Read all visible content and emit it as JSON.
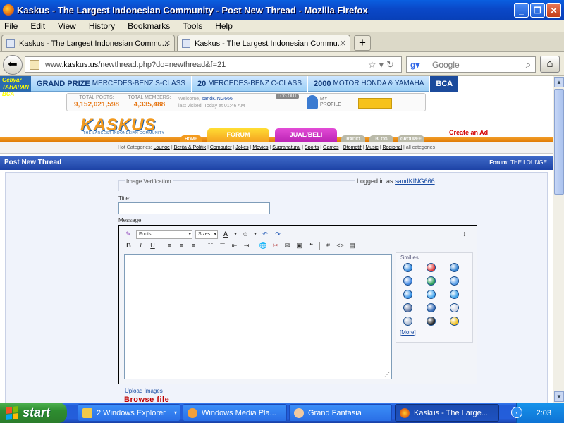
{
  "window": {
    "title": "Kaskus - The Largest Indonesian Community - Post New Thread - Mozilla Firefox"
  },
  "menu": [
    "File",
    "Edit",
    "View",
    "History",
    "Bookmarks",
    "Tools",
    "Help"
  ],
  "tabs": [
    {
      "label": "Kaskus - The Largest Indonesian Commu...",
      "active": false
    },
    {
      "label": "Kaskus - The Largest Indonesian Commu...",
      "active": true
    }
  ],
  "address": {
    "host": "www.",
    "domain": "kaskus.us",
    "path": "/newthread.php?do=newthread&f=21"
  },
  "search": {
    "placeholder": "Google"
  },
  "banner": {
    "logo": "Gebyar TAHAPAN BCA",
    "segments": [
      {
        "prefix": "GRAND PRIZE",
        "text": "MERCEDES-BENZ S-CLASS"
      },
      {
        "prefix": "20",
        "text": "MERCEDES-BENZ C-CLASS"
      },
      {
        "prefix": "2000",
        "text": "MOTOR HONDA & YAMAHA"
      }
    ],
    "bank": "BCA"
  },
  "userbox": {
    "posts_label": "TOTAL POSTS:",
    "posts": "9,152,021,598",
    "members_label": "TOTAL MEMBERS:",
    "members": "4,335,488",
    "welcome_prefix": "Welcome,",
    "username": "sandKING666",
    "last_visited": "last visited: Today at 01:46 AM",
    "logout": "LOG OUT",
    "profile_line1": "MY",
    "profile_line2": "PROFILE"
  },
  "site": {
    "logo": "KASKUS",
    "tagline": "THE LARGEST INDONESIAN COMMUNITY"
  },
  "nav": {
    "home": "HOME",
    "forum": "FORUM",
    "jualbeli": "JUAL/BELI",
    "radio": "RADIO",
    "blog": "BLOG",
    "groupee": "GROUPEE",
    "create_ad": "Create an Ad"
  },
  "hotcats": {
    "label": "Hot Categories:",
    "items": [
      "Lounge",
      "Berita & Politik",
      "Computer",
      "Jokes",
      "Movies",
      "Supranatural",
      "Sports",
      "Games",
      "Otomotif",
      "Music",
      "Regional"
    ],
    "all": "all categories"
  },
  "post": {
    "header": "Post New Thread",
    "forum_label": "Forum:",
    "forum_name": "THE LOUNGE",
    "image_verification": "Image Verification",
    "logged_in_prefix": "Logged in as",
    "logged_in_user": "sandKING666",
    "title_label": "Title:",
    "message_label": "Message:"
  },
  "editor": {
    "fonts": "Fonts",
    "sizes": "Sizes",
    "smilies_title": "Smilies",
    "more": "More"
  },
  "smilies_colors": [
    "#3a8ee0",
    "#e23a3a",
    "#2f7fd0",
    "#4a8ee6",
    "#2aa05a",
    "#5a9fe8",
    "#3b94e8",
    "#45a8f0",
    "#3aa0e8",
    "#6a7fa8",
    "#3c6fb8",
    "#cfd6e6",
    "#a8b8d0",
    "#222222",
    "#f0c020"
  ],
  "upload": {
    "label": "Upload Images",
    "browse": "Browse file"
  },
  "taskbar": {
    "start": "start",
    "items": [
      {
        "label": "2 Windows Explorer",
        "active": false
      },
      {
        "label": "Windows Media Pla...",
        "active": false
      },
      {
        "label": "Grand Fantasia",
        "active": false
      },
      {
        "label": "Kaskus - The Large...",
        "active": true
      }
    ],
    "clock": "2:03"
  }
}
